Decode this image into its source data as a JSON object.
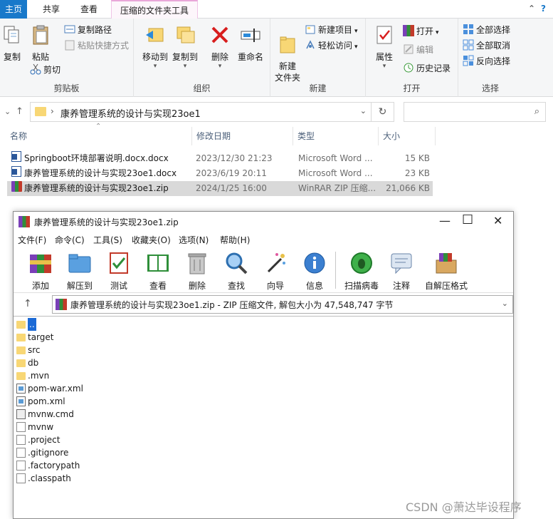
{
  "ribbon": {
    "tabs": [
      "主页",
      "共享",
      "查看",
      "压缩的文件夹工具"
    ],
    "groups": {
      "clipboard": {
        "label": "剪贴板",
        "copy": "复制",
        "paste": "粘贴",
        "copy_path": "复制路径",
        "paste_shortcut": "粘贴快捷方式",
        "cut": "剪切"
      },
      "organize": {
        "label": "组织",
        "move_to": "移动到",
        "copy_to": "复制到",
        "delete": "删除",
        "rename": "重命名"
      },
      "new": {
        "label": "新建",
        "new_folder": "新建\n文件夹",
        "new_item": "新建项目",
        "easy_access": "轻松访问"
      },
      "open": {
        "label": "打开",
        "properties": "属性",
        "open": "打开",
        "edit": "编辑",
        "history": "历史记录"
      },
      "select": {
        "label": "选择",
        "select_all": "全部选择",
        "select_none": "全部取消",
        "invert": "反向选择"
      }
    }
  },
  "address": {
    "path": "康养管理系统的设计与实现23oe1",
    "search_placeholder": ""
  },
  "columns": {
    "name": "名称",
    "date": "修改日期",
    "type": "类型",
    "size": "大小"
  },
  "files": [
    {
      "name": "Springboot环境部署说明.docx.docx",
      "date": "2023/12/30 21:23",
      "type": "Microsoft Word ...",
      "size": "15 KB",
      "icon": "word-icon"
    },
    {
      "name": "康养管理系统的设计与实现23oe1.docx",
      "date": "2023/6/19 20:11",
      "type": "Microsoft Word ...",
      "size": "23 KB",
      "icon": "word-icon"
    },
    {
      "name": "康养管理系统的设计与实现23oe1.zip",
      "date": "2024/1/25 16:00",
      "type": "WinRAR ZIP 压缩...",
      "size": "21,066 KB",
      "icon": "winrar-icon"
    }
  ],
  "winrar": {
    "title": "康养管理系统的设计与实现23oe1.zip",
    "menu": [
      "文件(F)",
      "命令(C)",
      "工具(S)",
      "收藏夹(O)",
      "选项(N)",
      "帮助(H)"
    ],
    "tools": [
      "添加",
      "解压到",
      "测试",
      "查看",
      "删除",
      "查找",
      "向导",
      "信息",
      "扫描病毒",
      "注释",
      "自解压格式"
    ],
    "path_text": "康养管理系统的设计与实现23oe1.zip - ZIP 压缩文件, 解包大小为 47,548,747 字节",
    "items": [
      {
        "name": "..",
        "kind": "folder"
      },
      {
        "name": "target",
        "kind": "folder"
      },
      {
        "name": "src",
        "kind": "folder"
      },
      {
        "name": "db",
        "kind": "folder"
      },
      {
        "name": ".mvn",
        "kind": "folder"
      },
      {
        "name": "pom-war.xml",
        "kind": "xml"
      },
      {
        "name": "pom.xml",
        "kind": "xml"
      },
      {
        "name": "mvnw.cmd",
        "kind": "cmd"
      },
      {
        "name": "mvnw",
        "kind": "file"
      },
      {
        "name": ".project",
        "kind": "file"
      },
      {
        "name": ".gitignore",
        "kind": "file"
      },
      {
        "name": ".factorypath",
        "kind": "file"
      },
      {
        "name": ".classpath",
        "kind": "file"
      }
    ]
  },
  "watermark": "CSDN @萧达毕设程序"
}
